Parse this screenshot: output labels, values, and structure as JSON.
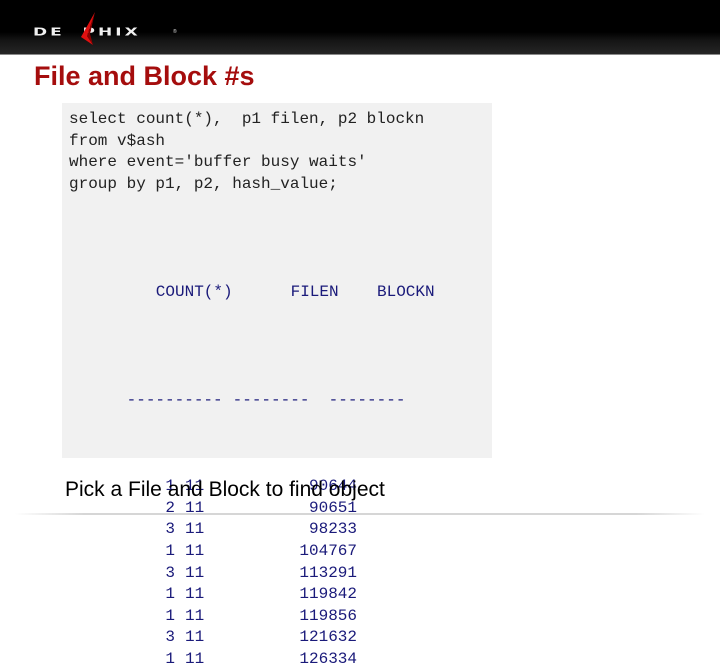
{
  "header": {
    "logo_text": "DE  PHIX",
    "logo_mark": "®",
    "logo_icon": "delphix-blade-logo"
  },
  "slide": {
    "title": "File and Block #s",
    "query_lines": [
      "select count(*),  p1 filen, p2 blockn",
      "from v$ash",
      "where event='buffer busy waits'",
      "group by p1, p2, hash_value;"
    ],
    "result": {
      "columns": [
        "COUNT(*)",
        "FILEN",
        "BLOCKN"
      ],
      "separators": [
        "----------",
        "--------",
        "--------"
      ],
      "rows": [
        [
          "1",
          "11",
          "90644"
        ],
        [
          "2",
          "11",
          "90651"
        ],
        [
          "3",
          "11",
          "98233"
        ],
        [
          "1",
          "11",
          "104767"
        ],
        [
          "3",
          "11",
          "113291"
        ],
        [
          "1",
          "11",
          "119842"
        ],
        [
          "1",
          "11",
          "119856"
        ],
        [
          "3",
          "11",
          "121632"
        ],
        [
          "1",
          "11",
          "126334"
        ]
      ]
    },
    "caption": "Pick a File and Block to find object"
  },
  "colors": {
    "title": "#a50d0d",
    "code_bg": "#f1f1f1",
    "result_text": "#1a1a7a",
    "logo_accent": "#e01010"
  }
}
